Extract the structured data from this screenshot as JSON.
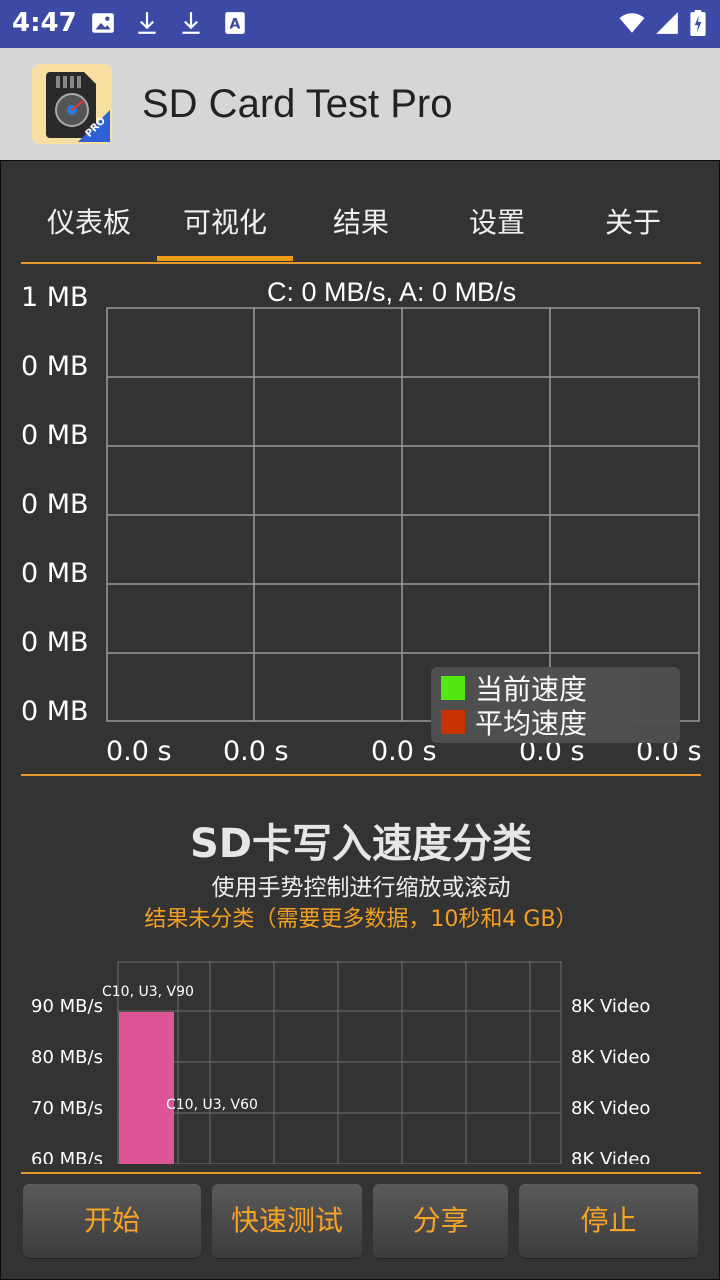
{
  "status_bar": {
    "time": "4:47",
    "icons": [
      "image-icon",
      "download-icon",
      "download-icon",
      "font-icon",
      "wifi-icon",
      "signal-icon",
      "battery-icon"
    ]
  },
  "app_bar": {
    "title": "SD Card Test Pro",
    "icon_badge": "PRO"
  },
  "tabs": [
    {
      "label": "仪表板",
      "active": false
    },
    {
      "label": "可视化",
      "active": true
    },
    {
      "label": "结果",
      "active": false
    },
    {
      "label": "设置",
      "active": false
    },
    {
      "label": "关于",
      "active": false
    }
  ],
  "colors": {
    "accent": "#f19a13",
    "current_speed": "#55ee11",
    "average_speed": "#cc3300",
    "bar": "#dd5599"
  },
  "speed_chart": {
    "title": "C: 0 MB/s, A: 0 MB/s",
    "y_labels": [
      "1 MB",
      "0 MB",
      "0 MB",
      "0 MB",
      "0 MB",
      "0 MB",
      "0 MB"
    ],
    "x_labels": [
      "0.0 s",
      "0.0 s",
      "0.0 s",
      "0.0 s",
      "0.0 s"
    ],
    "legend": [
      "当前速度",
      "平均速度"
    ]
  },
  "classification": {
    "title": "SD卡写入速度分类",
    "subtitle": "使用手势控制进行缩放或滚动",
    "status": "结果未分类（需要更多数据，10秒和4 GB）",
    "y_labels": [
      "90 MB/s",
      "80 MB/s",
      "70 MB/s",
      "60 MB/s"
    ],
    "right_labels": [
      "8K Video",
      "8K Video",
      "8K Video",
      "8K Video"
    ],
    "bars": [
      {
        "label": "C10, U3, V90",
        "value": 90
      },
      {
        "label": "C10, U3, V60",
        "value": 60
      }
    ]
  },
  "buttons": {
    "start": "开始",
    "quick_test": "快速测试",
    "share": "分享",
    "stop": "停止"
  }
}
